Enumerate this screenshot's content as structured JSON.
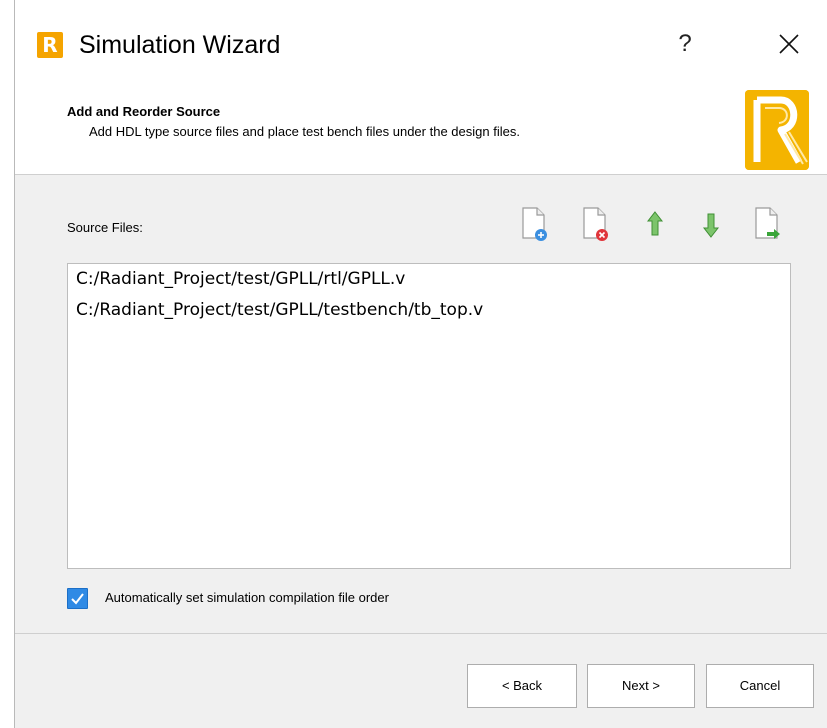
{
  "window": {
    "title": "Simulation Wizard",
    "app_icon_letter": "R",
    "help_label": "?",
    "close_icon": "close-icon"
  },
  "header": {
    "title": "Add and Reorder Source",
    "subtitle": "Add HDL type source files and place test bench files under the design files.",
    "logo_icon": "radiant-logo-icon"
  },
  "source": {
    "label": "Source Files:",
    "toolbar": [
      {
        "name": "add-file-icon",
        "tooltip": ""
      },
      {
        "name": "remove-file-icon",
        "tooltip": ""
      },
      {
        "name": "move-up-icon",
        "tooltip": ""
      },
      {
        "name": "move-down-icon",
        "tooltip": ""
      },
      {
        "name": "import-file-icon",
        "tooltip": ""
      }
    ],
    "files": [
      "C:/Radiant_Project/test/GPLL/rtl/GPLL.v",
      "C:/Radiant_Project/test/GPLL/testbench/tb_top.v"
    ]
  },
  "options": {
    "auto_order_label": "Automatically set simulation compilation file order",
    "auto_order_checked": true
  },
  "buttons": {
    "back": "< Back",
    "next": "Next >",
    "cancel": "Cancel"
  },
  "colors": {
    "accent_orange": "#f5a400",
    "checkbox_blue": "#2f8ae5",
    "arrow_green": "#4caf50"
  }
}
